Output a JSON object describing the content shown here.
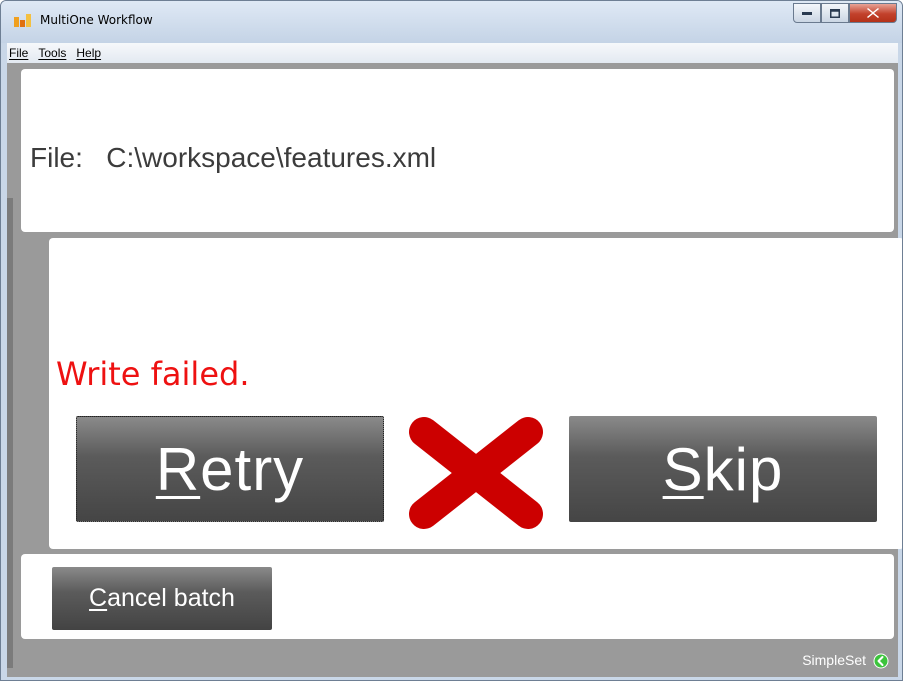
{
  "window": {
    "title": "MultiOne Workflow",
    "controls": {
      "minimize_icon": "minimize-icon",
      "maximize_icon": "maximize-icon",
      "close_icon": "close-icon"
    }
  },
  "menu": {
    "items": [
      {
        "label": "File"
      },
      {
        "label": "Tools"
      },
      {
        "label": "Help"
      }
    ]
  },
  "file": {
    "label": "File:",
    "path": "C:\\workspace\\features.xml"
  },
  "status": {
    "message": "Write failed.",
    "color": "#ee1111",
    "icon": "error-x-icon"
  },
  "actions": {
    "retry": {
      "mnemonic": "R",
      "rest": "etry"
    },
    "skip": {
      "mnemonic": "S",
      "rest": "kip"
    }
  },
  "cancel": {
    "mnemonic": "C",
    "rest": "ancel batch"
  },
  "footer": {
    "label": "SimpleSet",
    "icon": "simpleset-arrow-icon",
    "icon_color": "#3cc43c"
  },
  "colors": {
    "button_bg": "#5b5b5b",
    "x_mark": "#cc0000",
    "client_bg": "#9a9a9a"
  }
}
